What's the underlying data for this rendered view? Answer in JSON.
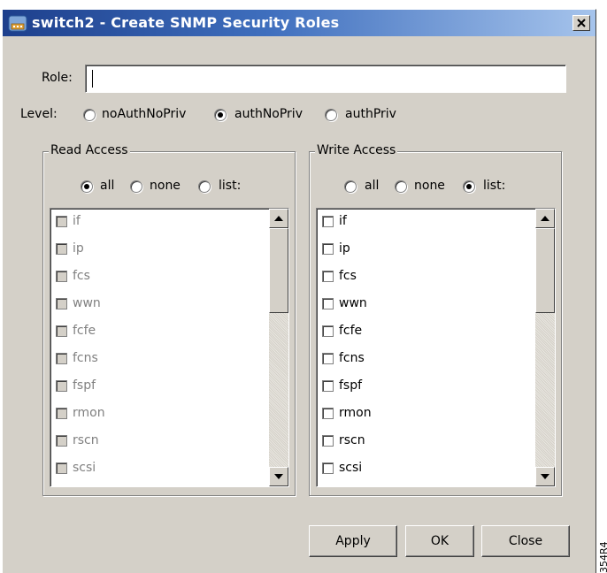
{
  "window": {
    "title": "switch2 - Create SNMP Security Roles"
  },
  "role": {
    "label": "Role:",
    "value": ""
  },
  "level": {
    "label": "Level:",
    "options": [
      "noAuthNoPriv",
      "authNoPriv",
      "authPriv"
    ],
    "selected": "authNoPriv"
  },
  "read_access": {
    "title": "Read Access",
    "options": [
      "all",
      "none",
      "list:"
    ],
    "selected": "all",
    "items": [
      "if",
      "ip",
      "fcs",
      "wwn",
      "fcfe",
      "fcns",
      "fspf",
      "rmon",
      "rscn",
      "scsi"
    ]
  },
  "write_access": {
    "title": "Write Access",
    "options": [
      "all",
      "none",
      "list:"
    ],
    "selected": "list:",
    "items": [
      "if",
      "ip",
      "fcs",
      "wwn",
      "fcfe",
      "fcns",
      "fspf",
      "rmon",
      "rscn",
      "scsi"
    ]
  },
  "buttons": {
    "apply": "Apply",
    "ok": "OK",
    "close": "Close"
  },
  "watermark": "354R4",
  "icons": {
    "app": "switch-app-icon",
    "close": "close-icon",
    "scroll_up": "scroll-up-arrow-icon",
    "scroll_down": "scroll-down-arrow-icon"
  }
}
